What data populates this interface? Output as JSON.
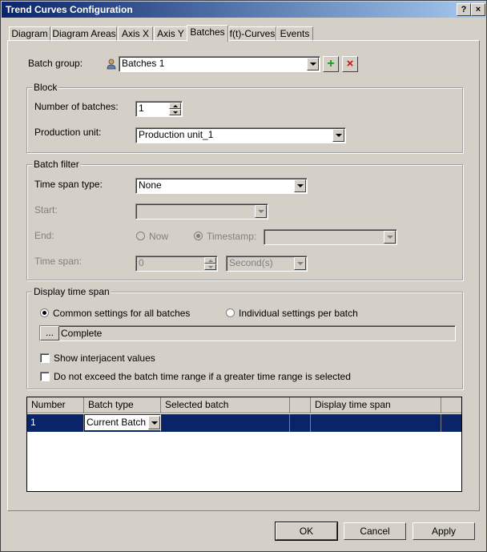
{
  "window": {
    "title": "Trend Curves Configuration",
    "help_label": "?",
    "close_label": "×"
  },
  "tabs": [
    {
      "label": "Diagram",
      "active": false
    },
    {
      "label": "Diagram Areas",
      "active": false
    },
    {
      "label": "Axis X",
      "active": false
    },
    {
      "label": "Axis Y",
      "active": false
    },
    {
      "label": "Batches",
      "active": true
    },
    {
      "label": "f(t)-Curves",
      "active": false
    },
    {
      "label": "Events",
      "active": false
    }
  ],
  "batch_group": {
    "label": "Batch group:",
    "value": "Batches 1",
    "add_label": "+",
    "delete_label": "×"
  },
  "block": {
    "title": "Block",
    "num_batches_label": "Number of batches:",
    "num_batches_value": "1",
    "production_unit_label": "Production unit:",
    "production_unit_value": "Production unit_1"
  },
  "batch_filter": {
    "title": "Batch filter",
    "time_span_type_label": "Time span type:",
    "time_span_type_value": "None",
    "start_label": "Start:",
    "start_value": "",
    "end_label": "End:",
    "now_label": "Now",
    "timestamp_label": "Timestamp:",
    "timestamp_value": "",
    "time_span_label": "Time span:",
    "time_span_value": "0",
    "time_span_unit": "Second(s)"
  },
  "display_time_span": {
    "title": "Display time span",
    "common_label": "Common settings for all batches",
    "individual_label": "Individual settings per batch",
    "browse_label": "...",
    "range_value": "Complete",
    "show_interjacent_label": "Show interjacent values",
    "not_exceed_label": "Do not exceed the batch time range if a greater time range is selected"
  },
  "grid": {
    "columns": [
      "Number",
      "Batch type",
      "Selected batch",
      "",
      "Display time span"
    ],
    "rows": [
      {
        "number": "1",
        "batch_type": "Current Batch",
        "selected_batch": "",
        "extra": "",
        "display_time_span": ""
      }
    ]
  },
  "buttons": {
    "ok": "OK",
    "cancel": "Cancel",
    "apply": "Apply"
  }
}
